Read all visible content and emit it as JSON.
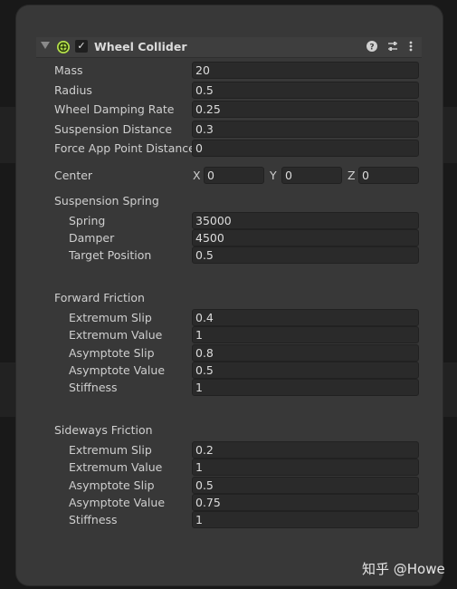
{
  "component": {
    "title": "Wheel Collider",
    "enabled": true,
    "icon": "wheel-collider-icon",
    "header_buttons": [
      "help-icon",
      "presets-icon",
      "more-options-icon"
    ]
  },
  "properties": {
    "mass": {
      "label": "Mass",
      "value": "20"
    },
    "radius": {
      "label": "Radius",
      "value": "0.5"
    },
    "wheel_damping_rate": {
      "label": "Wheel Damping Rate",
      "value": "0.25"
    },
    "suspension_distance": {
      "label": "Suspension Distance",
      "value": "0.3"
    },
    "force_app_point_distance": {
      "label": "Force App Point Distance",
      "value": "0"
    }
  },
  "center": {
    "label": "Center",
    "x_label": "X",
    "x": "0",
    "y_label": "Y",
    "y": "0",
    "z_label": "Z",
    "z": "0"
  },
  "suspension_spring": {
    "label": "Suspension Spring",
    "spring": {
      "label": "Spring",
      "value": "35000"
    },
    "damper": {
      "label": "Damper",
      "value": "4500"
    },
    "target_position": {
      "label": "Target Position",
      "value": "0.5"
    }
  },
  "forward_friction": {
    "label": "Forward Friction",
    "extremum_slip": {
      "label": "Extremum Slip",
      "value": "0.4"
    },
    "extremum_value": {
      "label": "Extremum Value",
      "value": "1"
    },
    "asymptote_slip": {
      "label": "Asymptote Slip",
      "value": "0.8"
    },
    "asymptote_value": {
      "label": "Asymptote Value",
      "value": "0.5"
    },
    "stiffness": {
      "label": "Stiffness",
      "value": "1"
    }
  },
  "sideways_friction": {
    "label": "Sideways Friction",
    "extremum_slip": {
      "label": "Extremum Slip",
      "value": "0.2"
    },
    "extremum_value": {
      "label": "Extremum Value",
      "value": "1"
    },
    "asymptote_slip": {
      "label": "Asymptote Slip",
      "value": "0.5"
    },
    "asymptote_value": {
      "label": "Asymptote Value",
      "value": "0.75"
    },
    "stiffness": {
      "label": "Stiffness",
      "value": "1"
    }
  },
  "watermark": "知乎 @Howe",
  "colors": {
    "panel": "#383838",
    "field": "#2a2a2a",
    "icon_green": "#b4e04a"
  }
}
